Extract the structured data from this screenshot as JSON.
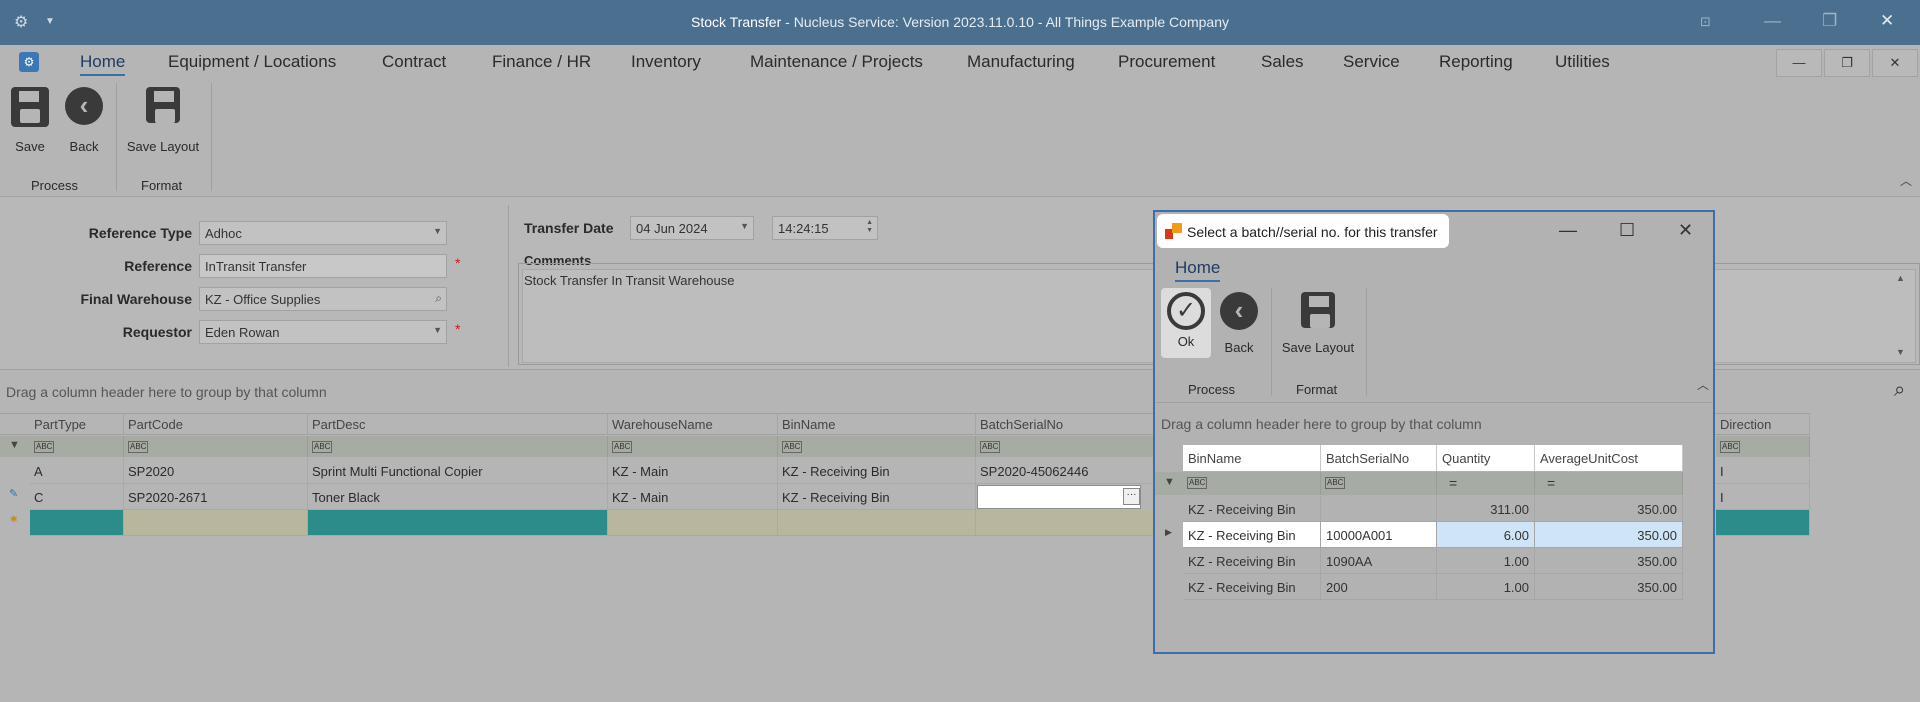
{
  "window": {
    "title_main": "Stock Transfer",
    "title_rest": " - Nucleus Service: Version 2023.11.0.10 - All Things Example Company"
  },
  "menu": {
    "items": [
      "Home",
      "Equipment / Locations",
      "Contract",
      "Finance / HR",
      "Inventory",
      "Maintenance / Projects",
      "Manufacturing",
      "Procurement",
      "Sales",
      "Service",
      "Reporting",
      "Utilities"
    ]
  },
  "ribbon": {
    "save": "Save",
    "back": "Back",
    "save_layout": "Save Layout",
    "group_process": "Process",
    "group_format": "Format"
  },
  "form": {
    "reference_type_label": "Reference Type",
    "reference_type_value": "Adhoc",
    "reference_label": "Reference",
    "reference_value": "InTransit Transfer",
    "final_warehouse_label": "Final Warehouse",
    "final_warehouse_value": "KZ - Office Supplies",
    "requestor_label": "Requestor",
    "requestor_value": "Eden Rowan",
    "transfer_date_label": "Transfer Date",
    "transfer_date_value": "04 Jun 2024",
    "transfer_time_value": "14:24:15",
    "comments_label": "Comments",
    "comments_value": "Stock Transfer In Transit Warehouse",
    "required_mark": "*"
  },
  "grid": {
    "group_hint": "Drag a column header here to group by that column",
    "columns": [
      "PartType",
      "PartCode",
      "PartDesc",
      "WarehouseName",
      "BinName",
      "BatchSerialNo",
      "Direction"
    ],
    "filter_abc": "ABC",
    "rows": [
      {
        "PartType": "A",
        "PartCode": "SP2020",
        "PartDesc": "Sprint Multi Functional Copier",
        "WarehouseName": "KZ - Main",
        "BinName": "KZ - Receiving Bin",
        "BatchSerialNo": "SP2020-45062446",
        "Direction": "I"
      },
      {
        "PartType": "C",
        "PartCode": "SP2020-2671",
        "PartDesc": "Toner Black",
        "WarehouseName": "KZ - Main",
        "BinName": "KZ - Receiving Bin",
        "BatchSerialNo": "",
        "Direction": "I"
      }
    ]
  },
  "dialog": {
    "title": "Select a batch//serial no. for this transfer",
    "tab_home": "Home",
    "ok": "Ok",
    "back": "Back",
    "save_layout": "Save Layout",
    "group_process": "Process",
    "group_format": "Format",
    "group_hint": "Drag a column header here to group by that column",
    "columns": [
      "BinName",
      "BatchSerialNo",
      "Quantity",
      "AverageUnitCost"
    ],
    "rows": [
      {
        "BinName": "KZ - Receiving Bin",
        "BatchSerialNo": "",
        "Quantity": "311.00",
        "AverageUnitCost": "350.00"
      },
      {
        "BinName": "KZ - Receiving Bin",
        "BatchSerialNo": "10000A001",
        "Quantity": "6.00",
        "AverageUnitCost": "350.00"
      },
      {
        "BinName": "KZ - Receiving Bin",
        "BatchSerialNo": "1090AA",
        "Quantity": "1.00",
        "AverageUnitCost": "350.00"
      },
      {
        "BinName": "KZ - Receiving Bin",
        "BatchSerialNo": "200",
        "Quantity": "1.00",
        "AverageUnitCost": "350.00"
      }
    ],
    "selected_row": 1
  }
}
